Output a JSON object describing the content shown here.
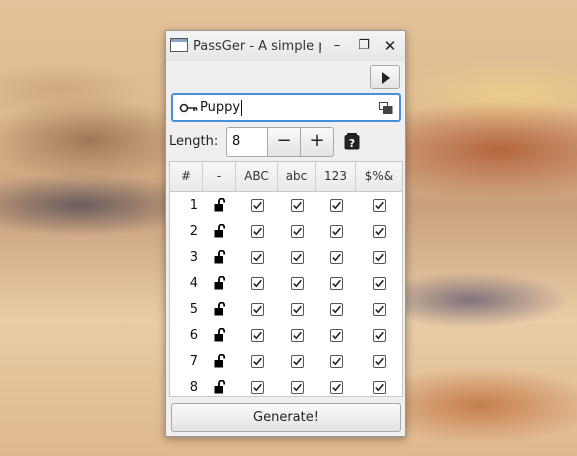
{
  "window": {
    "title": "PassGer - A simple password generator",
    "minimize_glyph": "–",
    "maximize_glyph": "❐",
    "close_glyph": "✕"
  },
  "search": {
    "value": "Puppy",
    "icon": "key-icon",
    "copy_icon": "copy-icon"
  },
  "length": {
    "label": "Length:",
    "value": "8",
    "minus": "−",
    "plus": "+"
  },
  "table": {
    "headers": [
      "#",
      "-",
      "ABC",
      "abc",
      "123",
      "$%&"
    ],
    "rows": [
      {
        "num": "1",
        "lock": "unlocked",
        "upper": true,
        "lower": true,
        "digits": true,
        "symbols": true
      },
      {
        "num": "2",
        "lock": "unlocked",
        "upper": true,
        "lower": true,
        "digits": true,
        "symbols": true
      },
      {
        "num": "3",
        "lock": "unlocked",
        "upper": true,
        "lower": true,
        "digits": true,
        "symbols": true
      },
      {
        "num": "4",
        "lock": "unlocked",
        "upper": true,
        "lower": true,
        "digits": true,
        "symbols": true
      },
      {
        "num": "5",
        "lock": "unlocked",
        "upper": true,
        "lower": true,
        "digits": true,
        "symbols": true
      },
      {
        "num": "6",
        "lock": "unlocked",
        "upper": true,
        "lower": true,
        "digits": true,
        "symbols": true
      },
      {
        "num": "7",
        "lock": "unlocked",
        "upper": true,
        "lower": true,
        "digits": true,
        "symbols": true
      },
      {
        "num": "8",
        "lock": "unlocked",
        "upper": true,
        "lower": true,
        "digits": true,
        "symbols": true
      }
    ]
  },
  "generate_label": "Generate!",
  "colors": {
    "focus": "#4a90d9"
  }
}
